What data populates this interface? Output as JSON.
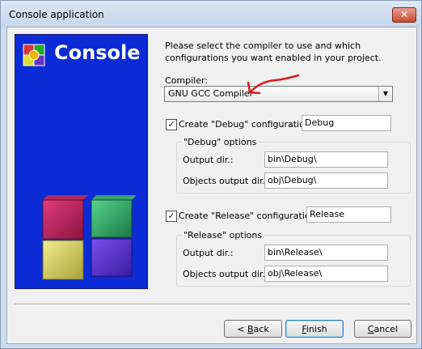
{
  "window": {
    "title": "Console application",
    "close_glyph": "✕"
  },
  "banner": {
    "title": "Console",
    "logo_icon": "gear-icon"
  },
  "description": "Please select the compiler to use and which configurations you want enabled in your project.",
  "compiler": {
    "label": "Compiler:",
    "value": "GNU GCC Compiler",
    "arrow": "▼"
  },
  "debug": {
    "checked": true,
    "check_glyph": "✓",
    "create_label": "Create \"Debug\" configuration:",
    "name": "Debug",
    "options_title": "\"Debug\" options",
    "output_label": "Output dir.:",
    "output_value": "bin\\Debug\\",
    "objects_label": "Objects output dir.:",
    "objects_value": "obj\\Debug\\"
  },
  "release": {
    "checked": true,
    "check_glyph": "✓",
    "create_label": "Create \"Release\" configuration:",
    "name": "Release",
    "options_title": "\"Release\" options",
    "output_label": "Output dir.:",
    "output_value": "bin\\Release\\",
    "objects_label": "Objects output dir.:",
    "objects_value": "obj\\Release\\"
  },
  "buttons": {
    "back_prefix": "< ",
    "back_mnemonic": "B",
    "back_rest": "ack",
    "finish_mnemonic": "F",
    "finish_rest": "inish",
    "cancel_mnemonic": "C",
    "cancel_rest": "ancel"
  },
  "colors": {
    "banner_bg": "#0a2bd6",
    "annotation": "#d81b1b"
  }
}
